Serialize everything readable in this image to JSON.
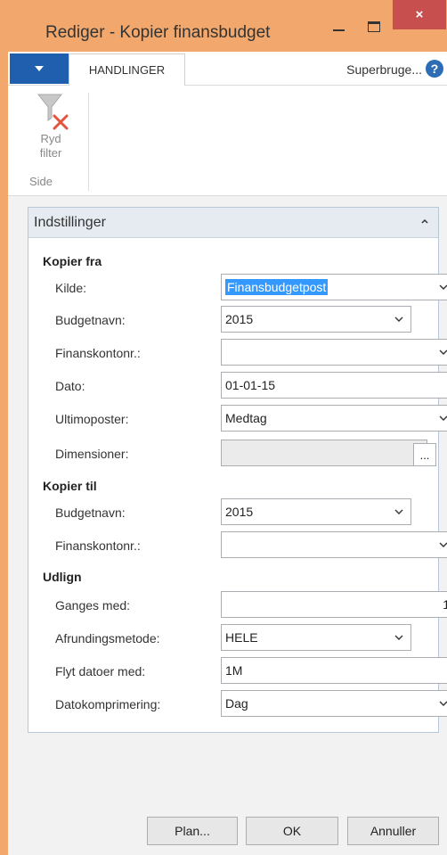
{
  "window": {
    "title": "Rediger - Kopier finansbudget",
    "close_glyph": "×"
  },
  "ribbon": {
    "tab_label": "HANDLINGER",
    "user_label": "Superbruge...",
    "help_glyph": "?",
    "clear_filter_line1": "Ryd",
    "clear_filter_line2": "filter",
    "clear_filter_icon": "funnel-with-red-x-icon",
    "group_label": "Side"
  },
  "panel": {
    "title": "Indstillinger",
    "sections": {
      "copy_from": "Kopier fra",
      "copy_to": "Kopier til",
      "adjust": "Udlign"
    },
    "fields": {
      "source": {
        "label": "Kilde:",
        "value": "Finansbudgetpost"
      },
      "from_budget": {
        "label": "Budgetnavn:",
        "value": "2015"
      },
      "from_account": {
        "label": "Finanskontonr.:",
        "value": ""
      },
      "date": {
        "label": "Dato:",
        "value": "01-01-15"
      },
      "closing": {
        "label": "Ultimoposter:",
        "value": "Medtag"
      },
      "dimensions": {
        "label": "Dimensioner:",
        "value": "",
        "assist": "..."
      },
      "to_budget": {
        "label": "Budgetnavn:",
        "value": "2015"
      },
      "to_account": {
        "label": "Finanskontonr.:",
        "value": ""
      },
      "multiply": {
        "label": "Ganges med:",
        "value": "1"
      },
      "rounding": {
        "label": "Afrundingsmetode:",
        "value": "HELE"
      },
      "shift_dates": {
        "label": "Flyt datoer med:",
        "value": "1M"
      },
      "date_compression": {
        "label": "Datokomprimering:",
        "value": "Dag"
      }
    }
  },
  "footer": {
    "plan_label": "Plan...",
    "ok_label": "OK",
    "cancel_label": "Annuller"
  },
  "colors": {
    "title_bar": "#F2A86C",
    "close_button": "#C7504F",
    "app_button": "#1F5FAE",
    "selection": "#3399FF"
  }
}
